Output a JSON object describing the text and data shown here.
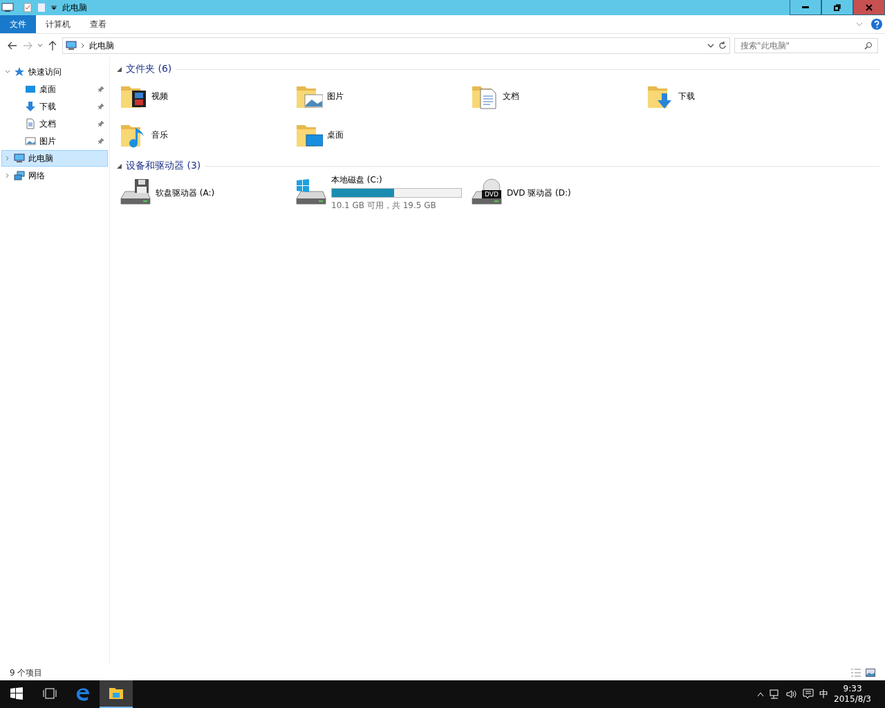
{
  "window": {
    "title": "此电脑"
  },
  "ribbon_tabs": [
    {
      "label": "文件",
      "selected": true
    },
    {
      "label": "计算机",
      "selected": false
    },
    {
      "label": "查看",
      "selected": false
    }
  ],
  "address": {
    "path": "此电脑"
  },
  "search": {
    "placeholder": "搜索\"此电脑\""
  },
  "nav": [
    {
      "label": "快速访问",
      "kind": "star",
      "expanded": true,
      "selected": false,
      "children": [
        {
          "label": "桌面",
          "kind": "desktop",
          "pinned": true
        },
        {
          "label": "下载",
          "kind": "download",
          "pinned": true
        },
        {
          "label": "文档",
          "kind": "document",
          "pinned": true
        },
        {
          "label": "图片",
          "kind": "picture",
          "pinned": true
        }
      ]
    },
    {
      "label": "此电脑",
      "kind": "computer",
      "expanded": false,
      "selected": true
    },
    {
      "label": "网络",
      "kind": "network",
      "expanded": false,
      "selected": false
    }
  ],
  "folders": {
    "title": "文件夹 (6)",
    "expanded": true,
    "items": [
      {
        "label": "视频",
        "kind": "video"
      },
      {
        "label": "图片",
        "kind": "picture"
      },
      {
        "label": "文档",
        "kind": "document"
      },
      {
        "label": "下载",
        "kind": "download"
      },
      {
        "label": "音乐",
        "kind": "music"
      },
      {
        "label": "桌面",
        "kind": "desktop"
      }
    ]
  },
  "drives": {
    "title": "设备和驱动器 (3)",
    "expanded": true,
    "items": [
      {
        "label": "软盘驱动器 (A:)",
        "kind": "floppy"
      },
      {
        "label": "本地磁盘 (C:)",
        "kind": "disk",
        "level": 0.48,
        "free_text": "10.1 GB 可用，共 19.5 GB"
      },
      {
        "label": "DVD 驱动器 (D:)",
        "kind": "dvd",
        "disc_label": "DVD"
      }
    ]
  },
  "status_bar": {
    "count": "9 个项目"
  },
  "taskbar": {
    "apps": [
      {
        "kind": "start",
        "selected": false
      },
      {
        "kind": "taskview",
        "selected": false
      },
      {
        "kind": "edge",
        "selected": false
      },
      {
        "kind": "explorer",
        "selected": true
      }
    ],
    "ime": "中",
    "time": "9:33",
    "date": "2015/8/3"
  }
}
